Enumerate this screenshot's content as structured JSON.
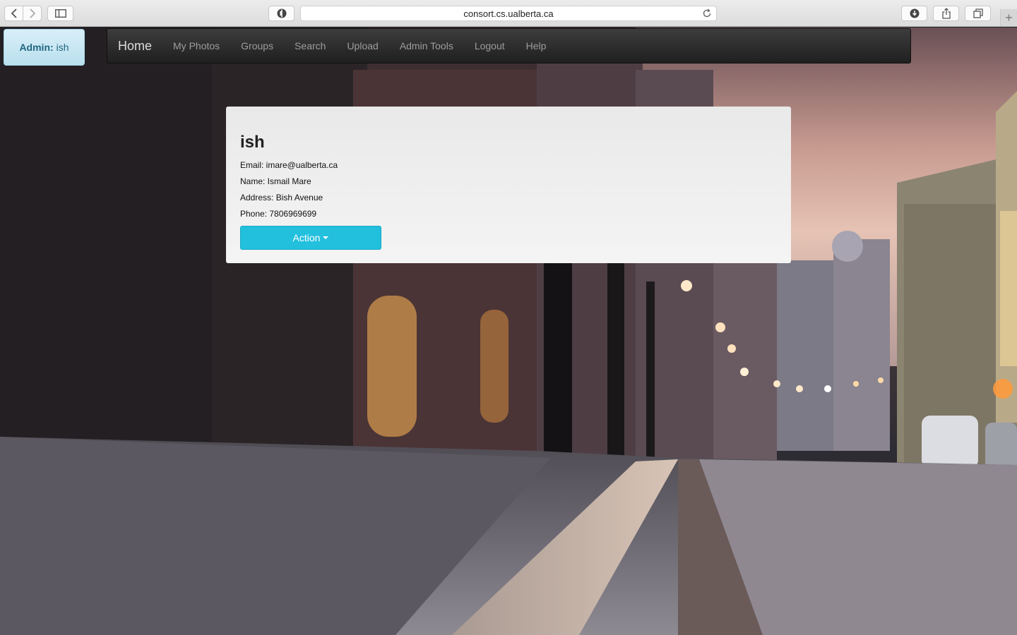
{
  "browser": {
    "url": "consort.cs.ualberta.ca",
    "new_tab_label": "+"
  },
  "admin": {
    "prefix": "Admin:",
    "username": "ish"
  },
  "navbar": {
    "brand": "Home",
    "links": [
      "My Photos",
      "Groups",
      "Search",
      "Upload",
      "Admin Tools",
      "Logout",
      "Help"
    ]
  },
  "profile": {
    "username": "ish",
    "email": "Email: imare@ualberta.ca",
    "name": "Name: Ismail Mare",
    "address": "Address: Bish Avenue",
    "phone": "Phone: 7806969699",
    "action_label": "Action"
  },
  "colors": {
    "navbar_bg": "#2a2a2a",
    "action_button": "#23c0de",
    "admin_badge_bg": "#c9e8f4",
    "panel_bg": "#eeeeee"
  }
}
